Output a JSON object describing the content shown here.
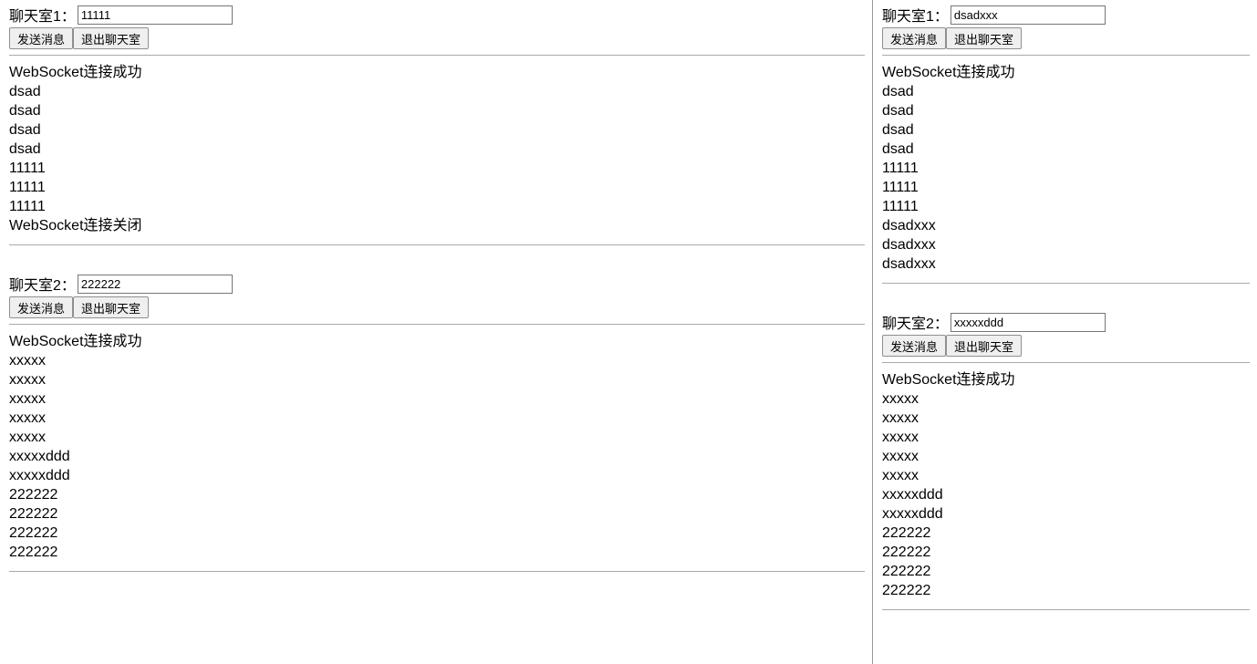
{
  "buttons": {
    "send": "发送消息",
    "exit": "退出聊天室"
  },
  "left": {
    "room1": {
      "label": "聊天室1：",
      "input": "11111",
      "messages": [
        "WebSocket连接成功",
        "dsad",
        "dsad",
        "dsad",
        "dsad",
        "11111",
        "11111",
        "11111",
        "WebSocket连接关闭"
      ]
    },
    "room2": {
      "label": "聊天室2：",
      "input": "222222",
      "messages": [
        "WebSocket连接成功",
        "xxxxx",
        "xxxxx",
        "xxxxx",
        "xxxxx",
        "xxxxx",
        "xxxxxddd",
        "xxxxxddd",
        "222222",
        "222222",
        "222222",
        "222222"
      ]
    }
  },
  "right": {
    "room1": {
      "label": "聊天室1：",
      "input": "dsadxxx",
      "messages": [
        "WebSocket连接成功",
        "dsad",
        "dsad",
        "dsad",
        "dsad",
        "11111",
        "11111",
        "11111",
        "dsadxxx",
        "dsadxxx",
        "dsadxxx"
      ]
    },
    "room2": {
      "label": "聊天室2：",
      "input": "xxxxxddd",
      "messages": [
        "WebSocket连接成功",
        "xxxxx",
        "xxxxx",
        "xxxxx",
        "xxxxx",
        "xxxxx",
        "xxxxxddd",
        "xxxxxddd",
        "222222",
        "222222",
        "222222",
        "222222"
      ]
    }
  }
}
